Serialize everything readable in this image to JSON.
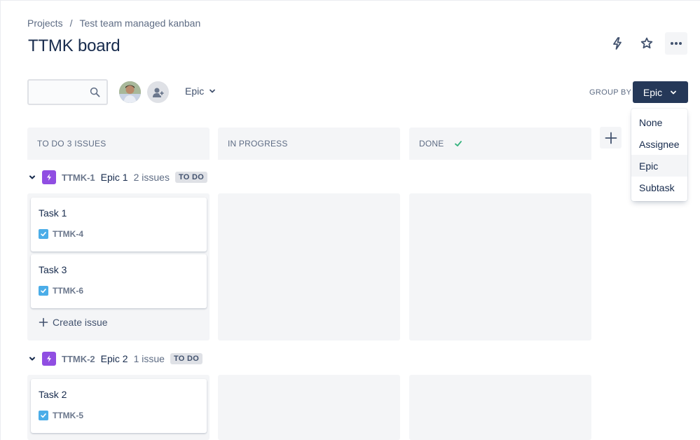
{
  "breadcrumb": {
    "root": "Projects",
    "separator": "/",
    "project": "Test team managed kanban"
  },
  "page": {
    "title": "TTMK board"
  },
  "header_actions": {
    "icons": [
      "lightning-icon",
      "star-icon",
      "more-icon"
    ]
  },
  "filters": {
    "search_placeholder": "",
    "epic_filter_label": "Epic"
  },
  "group_by": {
    "label": "GROUP BY",
    "selected": "Epic",
    "options": [
      "None",
      "Assignee",
      "Epic",
      "Subtask"
    ]
  },
  "columns": [
    {
      "title": "TO DO",
      "count": "3 ISSUES"
    },
    {
      "title": "IN PROGRESS"
    },
    {
      "title": "DONE"
    }
  ],
  "swimlanes": [
    {
      "key": "TTMK-1",
      "name": "Epic 1",
      "count": "2 issues",
      "status": "TO DO",
      "cards": [
        {
          "title": "Task 1",
          "key": "TTMK-4"
        },
        {
          "title": "Task 3",
          "key": "TTMK-6"
        }
      ],
      "create_label": "Create issue"
    },
    {
      "key": "TTMK-2",
      "name": "Epic 2",
      "count": "1 issue",
      "status": "TO DO",
      "cards": [
        {
          "title": "Task 2",
          "key": "TTMK-5"
        }
      ]
    }
  ],
  "colors": {
    "epic": "#904ee2",
    "task": "#4bade8",
    "primary": "#253858",
    "done": "#36b37e"
  }
}
